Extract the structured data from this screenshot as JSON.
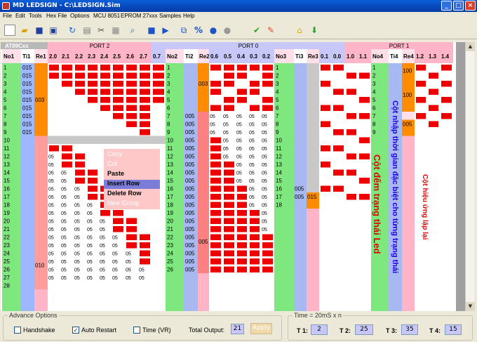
{
  "window": {
    "title": "MD LEDSIGN - C:\\LEDSIGN.Sim"
  },
  "menu": [
    "File",
    "Edit",
    "Tools",
    "Hex File",
    "Options",
    "MCU 8051",
    "EPROM 27xxx",
    "Samples",
    "Help"
  ],
  "toolbar": [
    "new-icon",
    "open-icon",
    "save-icon",
    "save-all-icon",
    "undo-icon",
    "copy-icon",
    "cut-icon",
    "paste-icon",
    "search-icon",
    "stop-icon",
    "play-icon",
    "copy-pages-icon",
    "percent-icon",
    "record-icon",
    "circle-icon",
    "check-icon",
    "edit-icon",
    "home-icon",
    "download-icon"
  ],
  "grid": {
    "chip": "AT89Cxx",
    "ports": [
      "PORT 2",
      "PORT 0",
      "PORT 1"
    ],
    "headers": [
      "No1",
      "Ti1",
      "Re1",
      "2.0",
      "2.1",
      "2.2",
      "2.3",
      "2.4",
      "2.5",
      "2.6",
      "2.7",
      "0.7",
      "No2",
      "Ti2",
      "Re2",
      "0.6",
      "0.5",
      "0.4",
      "0.3",
      "0.2",
      "No3",
      "Ti3",
      "Re3",
      "0.1",
      "0.0",
      "1.0",
      "1.1",
      "No4",
      "Ti4",
      "Re4",
      "1.2",
      "1.3",
      "1.4"
    ],
    "row_numbers": [
      1,
      2,
      3,
      4,
      5,
      6,
      7,
      8,
      9,
      10,
      11,
      12,
      13,
      14,
      15,
      16,
      17,
      18,
      19,
      20,
      21,
      22,
      23,
      24,
      25,
      26,
      27,
      28
    ],
    "ti1_values": [
      "015",
      "015",
      "015",
      "015",
      "015",
      "015",
      "015",
      "015",
      "015"
    ],
    "re1_values": [
      "003",
      "010"
    ],
    "no2_numbers": [
      1,
      2,
      3,
      4,
      5,
      6,
      7,
      8,
      9,
      10,
      11,
      12,
      13,
      14,
      15,
      16,
      17,
      18,
      19,
      20,
      21,
      22,
      23,
      24,
      25,
      26
    ],
    "ti2_values": [
      "005",
      "005",
      "005",
      "005",
      "005",
      "005",
      "005",
      "005",
      "005",
      "005",
      "005",
      "005",
      "005",
      "005",
      "005",
      "005",
      "005",
      "005",
      "005",
      "005"
    ],
    "re2_values": [
      "003",
      "005"
    ],
    "no3_numbers": [
      1,
      2,
      3,
      4,
      5,
      6,
      7,
      8,
      9,
      10,
      11,
      12,
      13,
      14,
      15,
      16,
      17,
      18
    ],
    "ti3_values": [
      "005",
      "005"
    ],
    "re3_values": [
      "015"
    ],
    "no4_numbers": [
      1,
      2,
      3,
      4,
      5,
      6,
      7,
      8,
      9
    ],
    "re4_values": [
      "100",
      "100",
      "005"
    ],
    "cell_value": "05"
  },
  "context_menu": {
    "items": [
      {
        "label": "Copy",
        "enabled": false
      },
      {
        "label": "Cut",
        "enabled": false
      },
      {
        "label": "Paste",
        "enabled": true
      },
      {
        "label": "Insert Row",
        "enabled": true,
        "selected": true
      },
      {
        "label": "Delete Row",
        "enabled": true
      },
      {
        "label": "New Group",
        "enabled": false
      }
    ]
  },
  "annotations": {
    "state_count": "Cột đếm trạng thái Led",
    "special_time": "Cột nhập thời gian đặc biệt cho từng trạng thái",
    "repeat_effect": "Cột hiệu ứng lặp lại"
  },
  "advance": {
    "title": "Advance Options",
    "handshake": {
      "label": "Handshake",
      "checked": false
    },
    "auto_restart": {
      "label": "Auto Restart",
      "checked": true
    },
    "time_vr": {
      "label": "Time (VR)",
      "checked": false
    },
    "total_output_label": "Total Output:",
    "total_output": "21",
    "apply": "Apply"
  },
  "timing": {
    "title": "Time = 20mS x n",
    "t1_label": "T 1:",
    "t1": "2",
    "t2_label": "T 2:",
    "t2": "25",
    "t3_label": "T 3:",
    "t3": "35",
    "t4_label": "T 4:",
    "t4": "15"
  },
  "colors": {
    "red": "#ee0000",
    "green": "#7ee87e",
    "pink": "#ffb4c8",
    "orange": "#ff8c00",
    "blue_header": "#c8c8f8",
    "gray": "#b8b8b8"
  }
}
